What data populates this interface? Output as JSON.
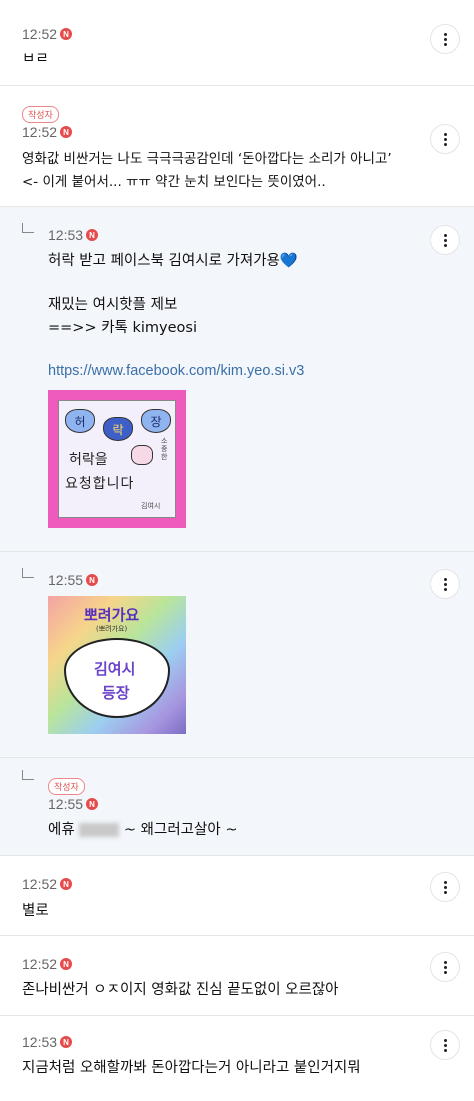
{
  "comments": [
    {
      "time": "12:52",
      "text": "ㅂㄹ"
    },
    {
      "author_badge": "작성자",
      "time": "12:52",
      "line1": "영화값 비싼거는 나도 극극극공감인데 ‘돈아깝다는 소리가 아니고’",
      "line2": "<- 이게 붙어서... ㅠㅠ 약간 눈치 보인다는 뜻이였어.."
    },
    {
      "time": "12:53",
      "line1": "허락 받고 페이스북 김여시로 가져가용💙",
      "line2": "재밌는 여시핫플 제보",
      "line3": "==>> 카톡 kimyeosi",
      "link": "https://www.facebook.com/kim.yeo.si.v3",
      "image": {
        "row1": [
          "허",
          "락",
          "장"
        ],
        "line1": "허락을",
        "line2": "요청합니다",
        "side": "소중한",
        "signature": "김여시"
      }
    },
    {
      "time": "12:55",
      "image": {
        "title": "뽀려가요",
        "subtitle": "(뽀려가요)",
        "line1": "김여시",
        "line2": "등장"
      }
    },
    {
      "author_badge": "작성자",
      "time": "12:55",
      "text_before": "에휴",
      "text_after": "~ 왜그러고살아 ~"
    },
    {
      "time": "12:52",
      "text": "별로"
    },
    {
      "time": "12:52",
      "text": "존나비싼거 ㅇㅈ이지 영화값 진심 끝도없이 오르잖아"
    },
    {
      "time": "12:53",
      "text": "지금처럼 오해할까봐 돈아깝다는거 아니라고 붙인거지뭐"
    }
  ],
  "badge": "N",
  "colors": {
    "badge": "#e54b4b",
    "reply_bg": "#f3f6fb",
    "link": "#3a6fa8",
    "author_badge": "#d55555"
  }
}
